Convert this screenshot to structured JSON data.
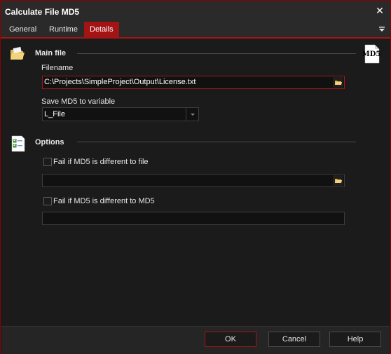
{
  "window": {
    "title": "Calculate File MD5"
  },
  "tabs": [
    {
      "label": "General"
    },
    {
      "label": "Runtime"
    },
    {
      "label": "Details"
    }
  ],
  "active_tab": "Details",
  "main_file": {
    "heading": "Main file",
    "badge": "MD5",
    "filename_label": "Filename",
    "filename_value": "C:\\Projects\\SimpleProject\\Output\\License.txt",
    "save_label": "Save MD5 to variable",
    "save_value": "L_File"
  },
  "options": {
    "heading": "Options",
    "fail_file_label": "Fail if MD5 is different to file",
    "fail_file_checked": false,
    "fail_file_value": "",
    "fail_md5_label": "Fail if MD5 is different to MD5",
    "fail_md5_checked": false,
    "fail_md5_value": ""
  },
  "buttons": {
    "ok": "OK",
    "cancel": "Cancel",
    "help": "Help"
  },
  "icons": {
    "close": "close-icon",
    "menu": "menu-arrow-icon",
    "folder": "folder-icon",
    "checklist": "checklist-icon",
    "browse": "browse-folder-icon"
  },
  "colors": {
    "accent": "#a31515",
    "background": "#1b1b1b",
    "text": "#e6e6e6"
  }
}
